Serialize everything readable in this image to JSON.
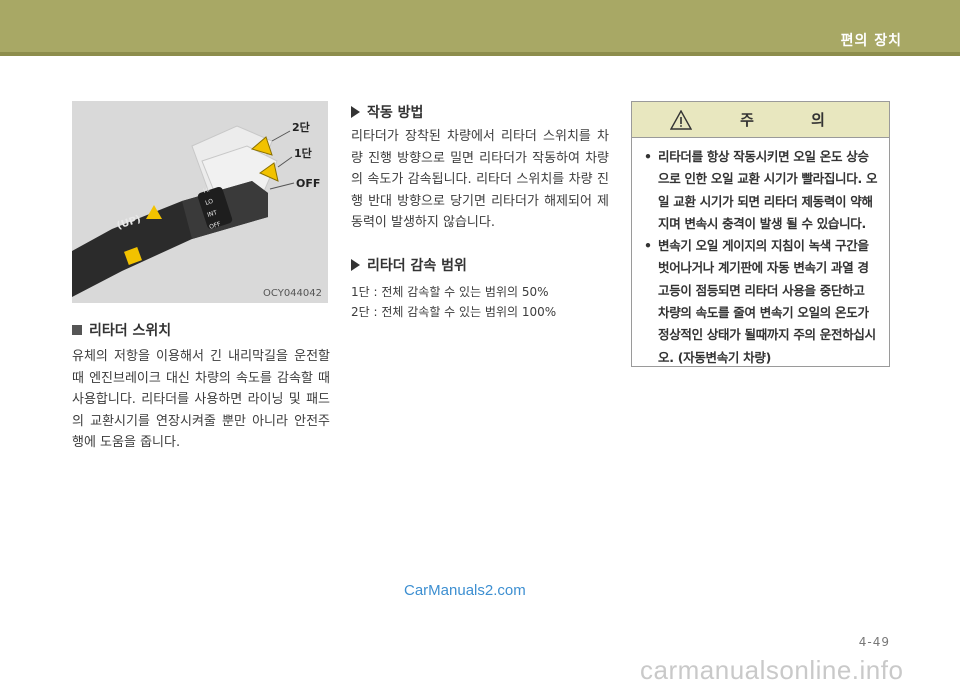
{
  "header": {
    "title": "편의 장치"
  },
  "figure": {
    "code": "OCY044042",
    "labels": {
      "stage2": "2단",
      "stage1": "1단",
      "off": "OFF",
      "up": "(UP)",
      "hi": "HI",
      "lo": "LO",
      "int": "INT",
      "off_small": "OFF"
    }
  },
  "section": {
    "title": "리타더 스위치",
    "paragraph": "유체의 저항을 이용해서 긴 내리막길을 운전할 때 엔진브레이크 대신 차량의 속도를 감속할 때 사용합니다. 리타더를 사용하면 라이닝 및 패드의 교환시기를 연장시켜줄 뿐만 아니라 안전주행에 도움을 줍니다."
  },
  "operation": {
    "title": "작동 방법",
    "paragraph": "리타더가 장착된 차량에서 리타더 스위치를 차량 진행 방향으로 밀면 리타더가 작동하여 차량의 속도가 감속됩니다. 리타더 스위치를 차량 진행 반대 방향으로 당기면 리타더가 해제되어 제동력이 발생하지 않습니다."
  },
  "range": {
    "title": "리타더 감속 범위",
    "lines": [
      "1단 : 전체 감속할 수 있는 범위의 50%",
      "2단 : 전체 감속할 수 있는 범위의 100%"
    ]
  },
  "caution": {
    "title": "주 의",
    "bullet": "•",
    "items": [
      "리타더를 항상 작동시키면 오일 온도 상승으로 인한 오일 교환 시기가 빨라집니다. 오일 교환 시기가 되면 리타더 제동력이 약해지며 변속시 충격이 발생 될 수 있습니다.",
      "변속기 오일 게이지의 지침이 녹색 구간을 벗어나거나 계기판에 자동 변속기 과열 경고등이 점등되면 리타더 사용을 중단하고 차량의 속도를 줄여 변속기 오일의 온도가 정상적인 상태가 될때까지 주의 운전하십시오. (자동변속기 차량)"
    ]
  },
  "watermark": "CarManuals2.com",
  "page_number": "4-49",
  "footer_mark": "carmanualsonline.info",
  "colors": {
    "header": "#a8a865",
    "caution_head": "#e8e7bf",
    "arrow": "#f2c200",
    "watermark": "#3d8fd1"
  }
}
